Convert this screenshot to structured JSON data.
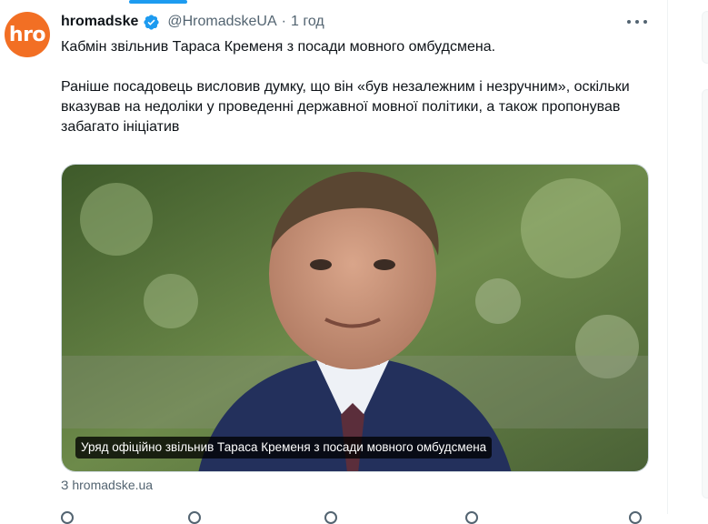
{
  "tweet": {
    "avatar_text": "hro",
    "display_name": "hromadske",
    "handle": "@HromadskeUA",
    "separator": "·",
    "time": "1 год",
    "text_line1": "Кабмін звільнив Тараса Кременя з посади мовного омбудсмена.",
    "text_line2": "Раніше посадовець висловив думку, що він «був незалежним і незручним», оскільки вказував на недоліки у проведенні державної мовної політики, а також пропонував забагато ініціатив",
    "media_caption": "Уряд офіційно звільнив Тараса Кременя з посади мовного омбудсмена",
    "source": "З hromadske.ua"
  },
  "colors": {
    "avatar_bg": "#f26f24",
    "verified": "#1d9bf0",
    "muted_text": "#536471",
    "tab_indicator": "#1d9bf0"
  },
  "icons": [
    "verified-badge-icon",
    "more-options-icon"
  ]
}
